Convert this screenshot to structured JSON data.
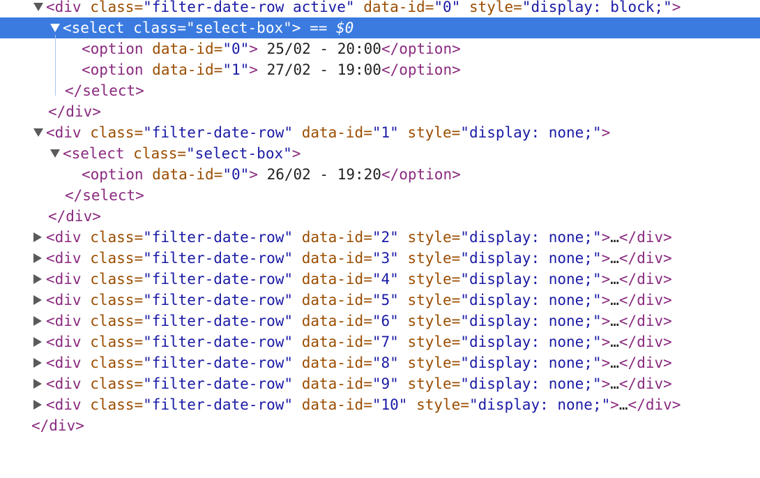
{
  "tree": {
    "row0": {
      "open": "<div",
      "a1": "class=",
      "v1": "\"filter-date-row active\"",
      "a2": "data-id=",
      "v2": "\"0\"",
      "a3": "style=",
      "v3": "\"display: block;\"",
      "close": ">"
    },
    "row1": {
      "open": "<select",
      "a1": "class=",
      "v1": "\"select-box\"",
      "close": ">",
      "eq": "==",
      "dollar": "$0"
    },
    "row2": {
      "open": "<option",
      "a1": "data-id=",
      "v1": "\"0\"",
      "close": ">",
      "text": " 25/02 - 20:00",
      "end": "</option>"
    },
    "row3": {
      "open": "<option",
      "a1": "data-id=",
      "v1": "\"1\"",
      "close": ">",
      "text": " 27/02 - 19:00",
      "end": "</option>"
    },
    "row4": {
      "end": "</select>"
    },
    "row5": {
      "end": "</div>"
    },
    "row6": {
      "open": "<div",
      "a1": "class=",
      "v1": "\"filter-date-row\"",
      "a2": "data-id=",
      "v2": "\"1\"",
      "a3": "style=",
      "v3": "\"display: none;\"",
      "close": ">"
    },
    "row7": {
      "open": "<select",
      "a1": "class=",
      "v1": "\"select-box\"",
      "close": ">"
    },
    "row8": {
      "open": "<option",
      "a1": "data-id=",
      "v1": "\"0\"",
      "close": ">",
      "text": " 26/02 - 19:20",
      "end": "</option>"
    },
    "row9": {
      "end": "</select>"
    },
    "row10": {
      "end": "</div>"
    },
    "row11": {
      "open": "<div",
      "a1": "class=",
      "v1": "\"filter-date-row\"",
      "a2": "data-id=",
      "v2": "\"2\"",
      "a3": "style=",
      "v3": "\"display: none;\"",
      "close": ">",
      "ellipsis": "…",
      "end": "</div>"
    },
    "row12": {
      "open": "<div",
      "a1": "class=",
      "v1": "\"filter-date-row\"",
      "a2": "data-id=",
      "v2": "\"3\"",
      "a3": "style=",
      "v3": "\"display: none;\"",
      "close": ">",
      "ellipsis": "…",
      "end": "</div>"
    },
    "row13": {
      "open": "<div",
      "a1": "class=",
      "v1": "\"filter-date-row\"",
      "a2": "data-id=",
      "v2": "\"4\"",
      "a3": "style=",
      "v3": "\"display: none;\"",
      "close": ">",
      "ellipsis": "…",
      "end": "</div>"
    },
    "row14": {
      "open": "<div",
      "a1": "class=",
      "v1": "\"filter-date-row\"",
      "a2": "data-id=",
      "v2": "\"5\"",
      "a3": "style=",
      "v3": "\"display: none;\"",
      "close": ">",
      "ellipsis": "…",
      "end": "</div>"
    },
    "row15": {
      "open": "<div",
      "a1": "class=",
      "v1": "\"filter-date-row\"",
      "a2": "data-id=",
      "v2": "\"6\"",
      "a3": "style=",
      "v3": "\"display: none;\"",
      "close": ">",
      "ellipsis": "…",
      "end": "</div>"
    },
    "row16": {
      "open": "<div",
      "a1": "class=",
      "v1": "\"filter-date-row\"",
      "a2": "data-id=",
      "v2": "\"7\"",
      "a3": "style=",
      "v3": "\"display: none;\"",
      "close": ">",
      "ellipsis": "…",
      "end": "</div>"
    },
    "row17": {
      "open": "<div",
      "a1": "class=",
      "v1": "\"filter-date-row\"",
      "a2": "data-id=",
      "v2": "\"8\"",
      "a3": "style=",
      "v3": "\"display: none;\"",
      "close": ">",
      "ellipsis": "…",
      "end": "</div>"
    },
    "row18": {
      "open": "<div",
      "a1": "class=",
      "v1": "\"filter-date-row\"",
      "a2": "data-id=",
      "v2": "\"9\"",
      "a3": "style=",
      "v3": "\"display: none;\"",
      "close": ">",
      "ellipsis": "…",
      "end": "</div>"
    },
    "row19": {
      "open": "<div",
      "a1": "class=",
      "v1": "\"filter-date-row\"",
      "a2": "data-id=",
      "v2": "\"10\"",
      "a3": "style=",
      "v3": "\"display: none;\"",
      "close": ">",
      "ellipsis": "…",
      "end": "</div>"
    },
    "row20": {
      "end": "</div>"
    }
  },
  "colors": {
    "selection": "#3b7be0",
    "tag": "#8a2a7f",
    "attr_name": "#9b4d00",
    "attr_value": "#1a1aa6",
    "guide": "#a9c4ef"
  },
  "icons": {
    "expanded": "triangle-down-icon",
    "collapsed": "triangle-right-icon"
  }
}
